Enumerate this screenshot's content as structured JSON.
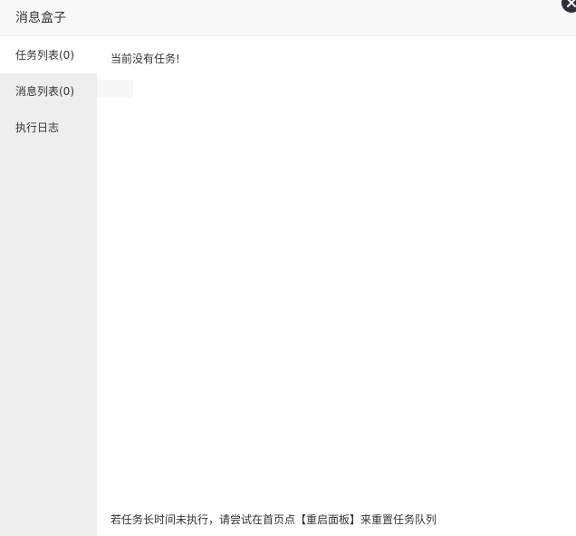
{
  "dialog": {
    "title": "消息盒子",
    "close_icon": "close-icon"
  },
  "tabs": [
    {
      "label": "任务列表(0)",
      "active": true
    },
    {
      "label": "消息列表(0)",
      "active": false
    },
    {
      "label": "执行日志",
      "active": false
    }
  ],
  "content": {
    "empty_message": "当前没有任务!",
    "footer_tip": "若任务长时间未执行，请尝试在首页点【重启面板】来重置任务队列"
  },
  "colors": {
    "title_bar_bg": "#f8f8f8",
    "sidebar_bg": "#eeeeee",
    "active_tab_bg": "#ffffff",
    "close_button_bg": "#2e2d3c"
  }
}
